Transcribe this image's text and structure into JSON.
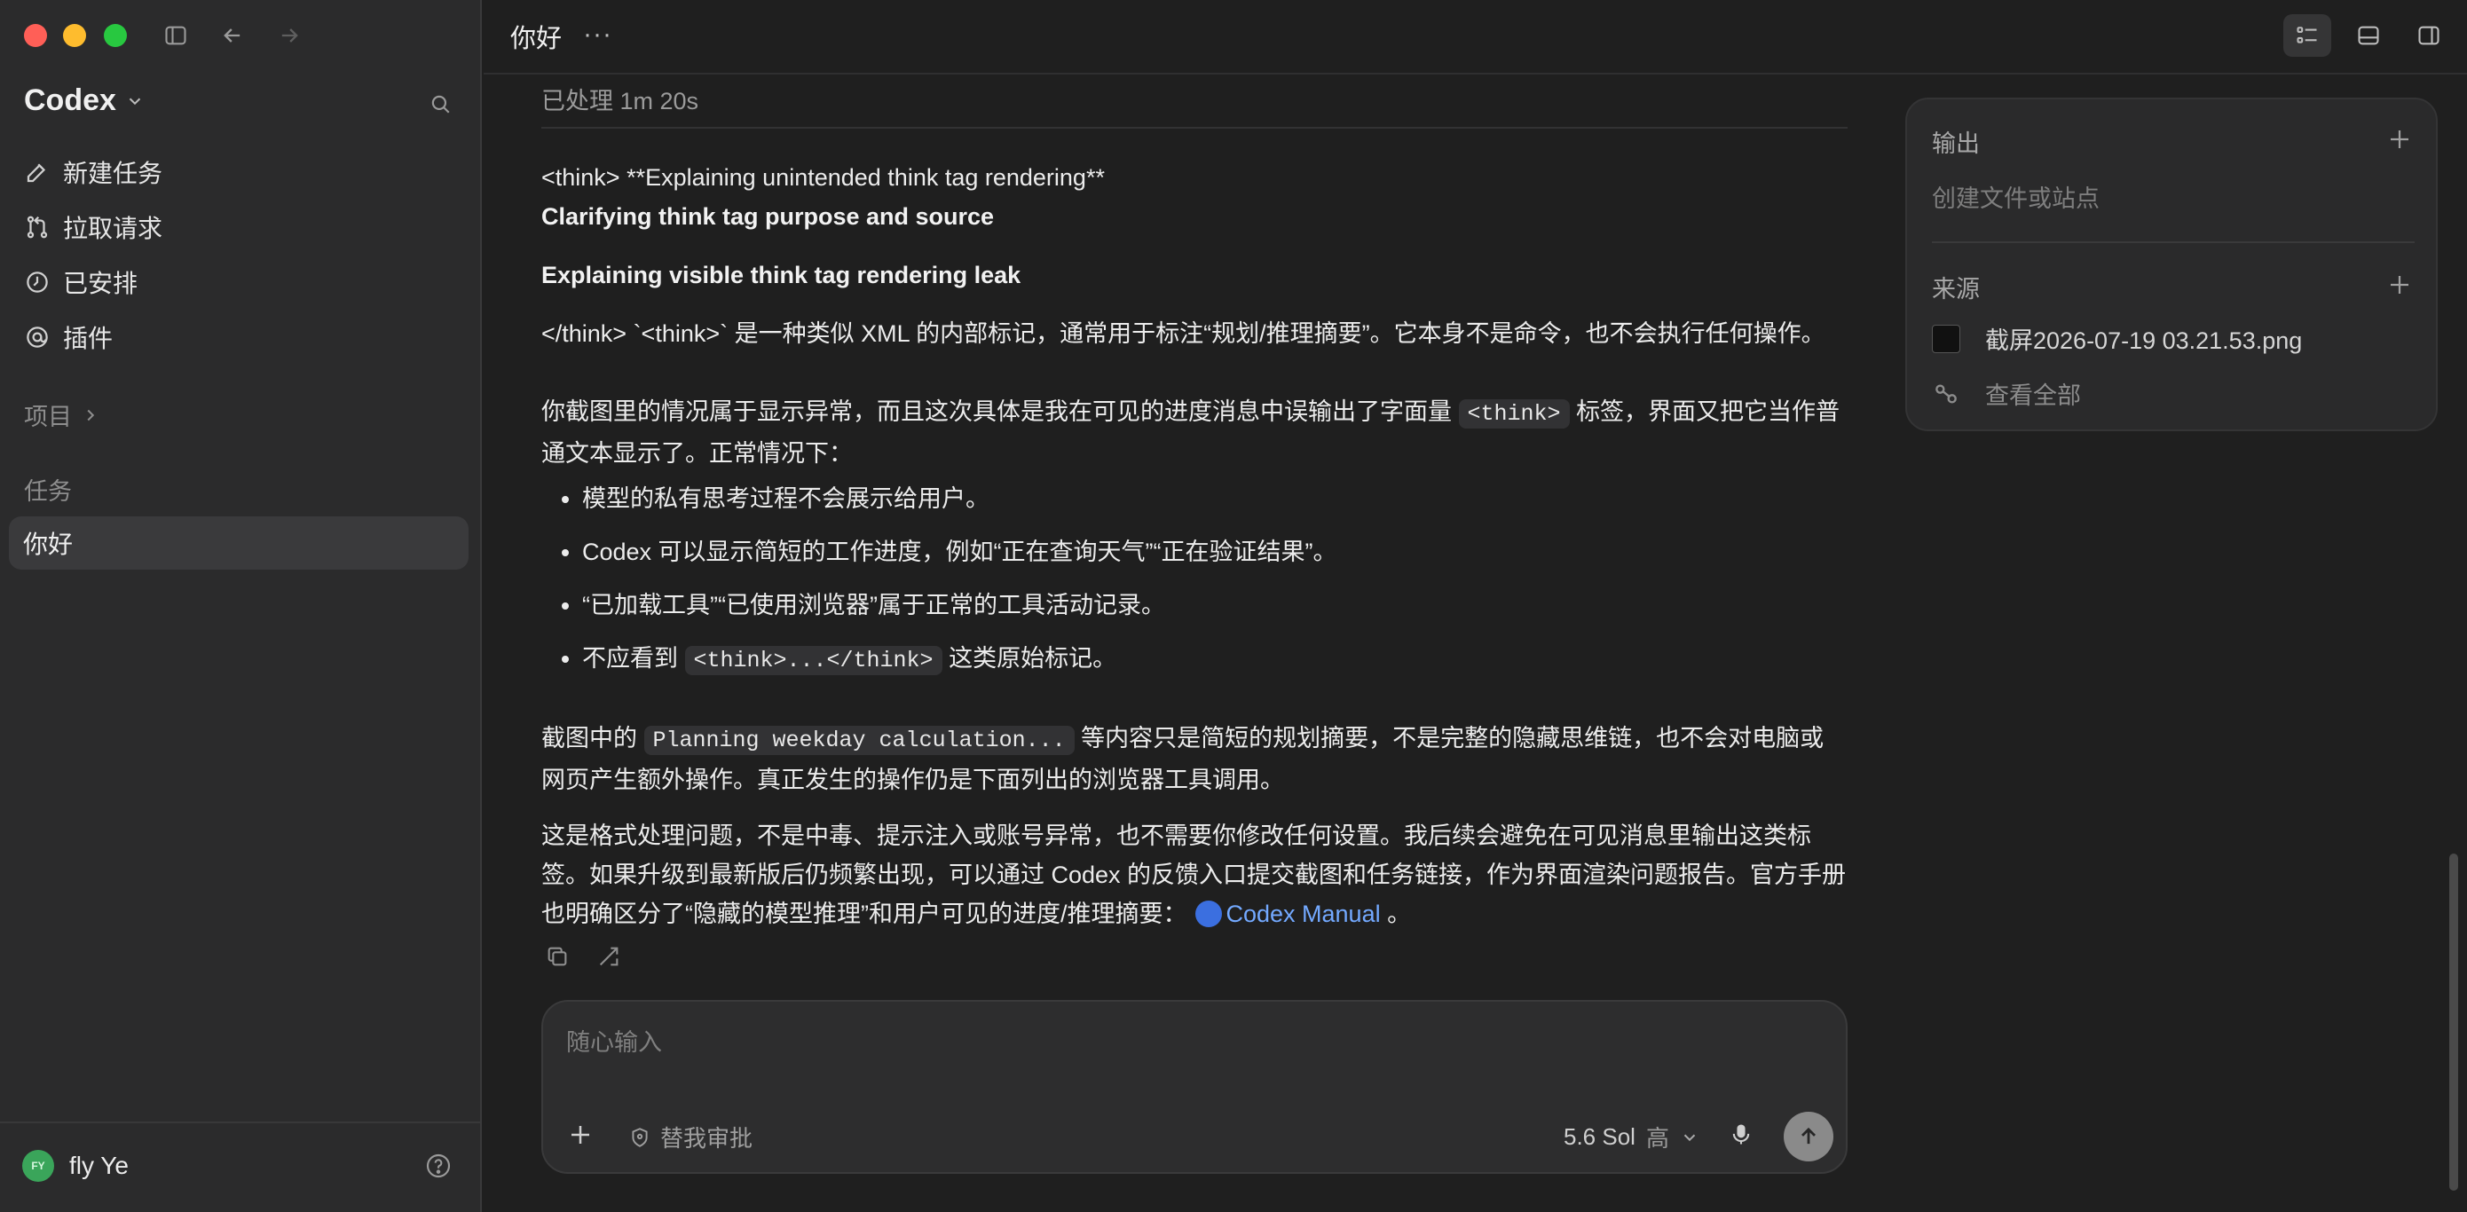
{
  "colors": {
    "accent_link": "#73a9ff",
    "traffic_red": "#ff5f57",
    "traffic_yellow": "#febc2e",
    "traffic_green": "#28c840",
    "avatar_bg": "#3aa55a"
  },
  "sidebar": {
    "app_name": "Codex",
    "nav": [
      {
        "label": "新建任务",
        "icon": "edit-icon"
      },
      {
        "label": "拉取请求",
        "icon": "pull-request-icon"
      },
      {
        "label": "已安排",
        "icon": "clock-icon"
      },
      {
        "label": "插件",
        "icon": "plugin-icon"
      }
    ],
    "projects_label": "项目",
    "tasks_label": "任务",
    "tasks": [
      {
        "label": "你好"
      }
    ],
    "user": {
      "initials": "FY",
      "name": "fly Ye"
    }
  },
  "topbar": {
    "title": "你好",
    "more": "···"
  },
  "conversation": {
    "processed": "已处理 1m 20s",
    "line1": "<think> **Explaining unintended think tag rendering**",
    "heading1": "Clarifying think tag purpose and source",
    "heading2": "Explaining visible think tag rendering leak",
    "para1": "</think> `<think>` 是一种类似 XML 的内部标记，通常用于标注“规划/推理摘要”。它本身不是命令，也不会执行任何操作。",
    "para2_pre": "你截图里的情况属于显示异常，而且这次具体是我在可见的进度消息中误输出了字面量",
    "para2_code": "<think>",
    "para2_post": "标签，界面又把它当作普通文本显示了。正常情况下：",
    "bullet1": "模型的私有思考过程不会展示给用户。",
    "bullet2": "Codex 可以显示简短的工作进度，例如“正在查询天气”“正在验证结果”。",
    "bullet3": "“已加载工具”“已使用浏览器”属于正常的工具活动记录。",
    "bullet4_pre": "不应看到",
    "bullet4_code": "<think>...</think>",
    "bullet4_post": "这类原始标记。",
    "para3_pre": "截图中的",
    "para3_code": "Planning weekday calculation...",
    "para3_post": "等内容只是简短的规划摘要，不是完整的隐藏思维链，也不会对电脑或网页产生额外操作。真正发生的操作仍是下面列出的浏览器工具调用。",
    "para4": "这是格式处理问题，不是中毒、提示注入或账号异常，也不需要你修改任何设置。我后续会避免在可见消息里输出这类标签。如果升级到最新版后仍频繁出现，可以通过 Codex 的反馈入口提交截图和任务链接，作为界面渲染问题报告。官方手册也明确区分了“隐藏的模型推理”和用户可见的进度/推理摘要：",
    "link_text": "Codex Manual",
    "para4_end": "。"
  },
  "composer": {
    "placeholder": "随心输入",
    "approve_label": "替我审批",
    "model": "5.6 Sol",
    "effort": "高"
  },
  "side_panel": {
    "output_label": "输出",
    "output_hint": "创建文件或站点",
    "sources_label": "来源",
    "file_name": "截屏2026-07-19 03.21.53.png",
    "view_all": "查看全部"
  }
}
